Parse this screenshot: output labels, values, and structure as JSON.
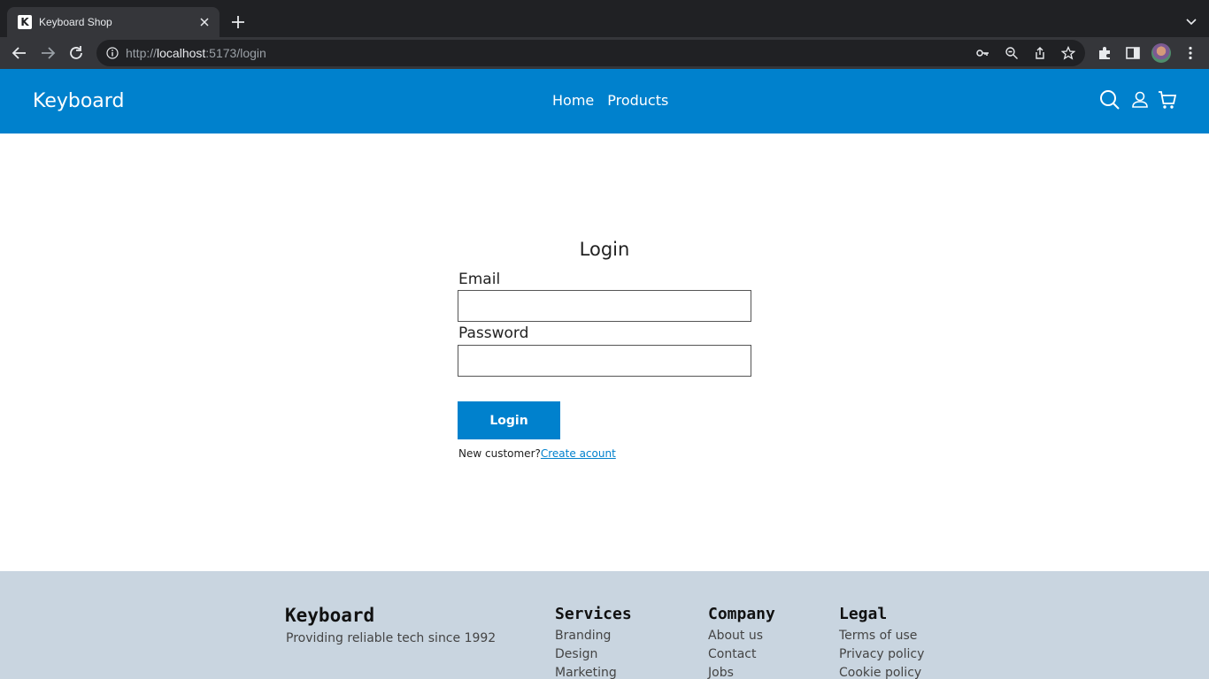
{
  "browser": {
    "tab_title": "Keyboard Shop",
    "favicon_letter": "K",
    "url_prefix": "http://",
    "url_host": "localhost",
    "url_rest": ":5173/login"
  },
  "header": {
    "brand": "Keyboard",
    "nav": {
      "home": "Home",
      "products": "Products"
    },
    "icons": [
      "search-icon",
      "user-icon",
      "cart-icon"
    ],
    "background": "#0081cd"
  },
  "login": {
    "title": "Login",
    "email_label": "Email",
    "email_value": "",
    "password_label": "Password",
    "password_value": "",
    "submit_label": "Login",
    "new_customer_text": "New customer?",
    "create_account_link": "Create acount"
  },
  "footer": {
    "brand": "Keyboard",
    "tagline": "Providing reliable tech since 1992",
    "columns": [
      {
        "title": "Services",
        "links": [
          "Branding",
          "Design",
          "Marketing"
        ]
      },
      {
        "title": "Company",
        "links": [
          "About us",
          "Contact",
          "Jobs"
        ]
      },
      {
        "title": "Legal",
        "links": [
          "Terms of use",
          "Privacy policy",
          "Cookie policy"
        ]
      }
    ],
    "background": "#c9d5e0"
  }
}
